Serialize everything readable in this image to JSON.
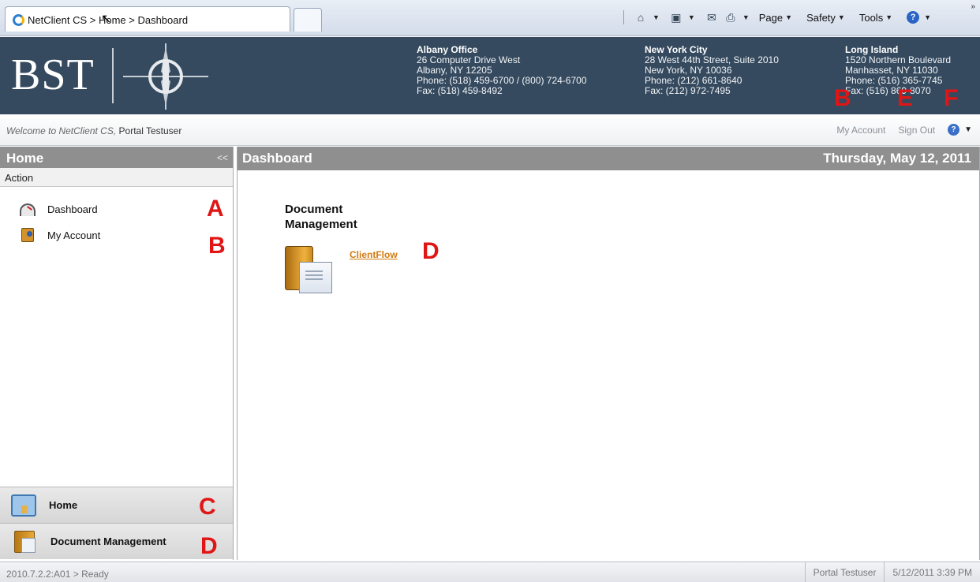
{
  "browser": {
    "tab_title": "NetClient CS > Home > Dashboard",
    "commands": {
      "page": "Page",
      "safety": "Safety",
      "tools": "Tools"
    }
  },
  "header": {
    "logo_text": "BST",
    "offices": [
      {
        "name": "Albany Office",
        "lines": [
          "26 Computer Drive West",
          "Albany, NY 12205",
          "Phone: (518) 459-6700 / (800) 724-6700",
          "Fax: (518) 459-8492"
        ]
      },
      {
        "name": "New York City",
        "lines": [
          "28 West 44th Street, Suite 2010",
          "New York, NY 10036",
          "Phone: (212) 661-8640",
          "Fax: (212) 972-7495"
        ]
      },
      {
        "name": "Long Island",
        "lines": [
          "1520 Northern Boulevard",
          "Manhasset, NY 11030",
          "Phone: (516) 365-7745",
          "Fax: (516) 869-8070"
        ]
      }
    ]
  },
  "welcome": {
    "greeting": "Welcome to NetClient CS,",
    "user": "Portal Testuser",
    "my_account": "My Account",
    "sign_out": "Sign Out"
  },
  "left": {
    "title": "Home",
    "collapse": "<<",
    "action_label": "Action",
    "items": [
      {
        "label": "Dashboard",
        "icon": "dashboard-gauge-icon"
      },
      {
        "label": "My Account",
        "icon": "user-card-icon"
      }
    ],
    "nav": [
      {
        "label": "Home",
        "icon": "house-icon"
      },
      {
        "label": "Document Management",
        "icon": "folder-document-icon"
      }
    ]
  },
  "main": {
    "title": "Dashboard",
    "date": "Thursday, May 12, 2011",
    "section_title": "Document Management",
    "link": "ClientFlow"
  },
  "annotations": {
    "A": "A",
    "B": "B",
    "C": "C",
    "D": "D",
    "E": "E",
    "F": "F"
  },
  "status": {
    "version": "2010.7.2.2:A01 > Ready",
    "user": "Portal Testuser",
    "datetime": "5/12/2011 3:39 PM"
  },
  "colors": {
    "header_bg": "#354a5f",
    "panel_header_bg": "#8f8f8f",
    "link": "#d27a10",
    "annotation": "#e01515"
  }
}
